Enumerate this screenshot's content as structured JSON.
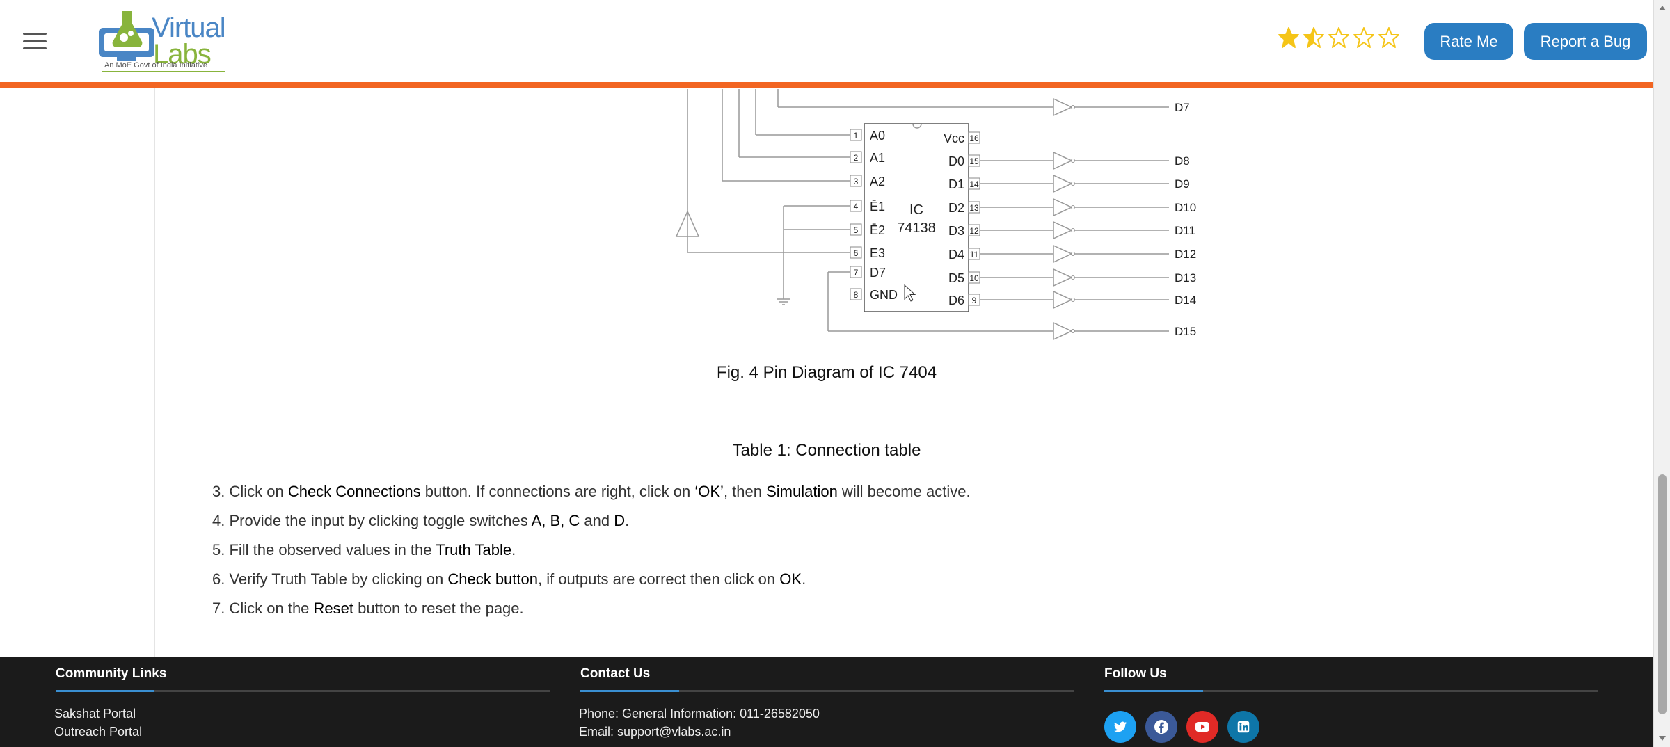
{
  "header": {
    "logo": {
      "line1": "Virtual",
      "line2": "Labs",
      "tagline": "An MoE Govt of India Initiative"
    },
    "rating": {
      "value": 1.5,
      "max": 5
    },
    "rate_label": "Rate Me",
    "bug_label": "Report a Bug"
  },
  "diagram": {
    "ic_label": "IC",
    "ic_number": "74138",
    "left_pins": [
      {
        "num": "1",
        "name": "A0"
      },
      {
        "num": "2",
        "name": "A1"
      },
      {
        "num": "3",
        "name": "A2"
      },
      {
        "num": "4",
        "name": "Ē1"
      },
      {
        "num": "5",
        "name": "Ē2"
      },
      {
        "num": "6",
        "name": "E3"
      },
      {
        "num": "7",
        "name": "D7"
      },
      {
        "num": "8",
        "name": "GND"
      }
    ],
    "right_pins": [
      {
        "num": "16",
        "name": "Vcc"
      },
      {
        "num": "15",
        "name": "D0"
      },
      {
        "num": "14",
        "name": "D1"
      },
      {
        "num": "13",
        "name": "D2"
      },
      {
        "num": "12",
        "name": "D3"
      },
      {
        "num": "11",
        "name": "D4"
      },
      {
        "num": "10",
        "name": "D5"
      },
      {
        "num": "9",
        "name": "D6"
      }
    ],
    "outputs": [
      "D7",
      "D8",
      "D9",
      "D10",
      "D11",
      "D12",
      "D13",
      "D14",
      "D15"
    ]
  },
  "content": {
    "fig_caption": "Fig. 4 Pin Diagram of IC 7404",
    "table_caption": "Table 1: Connection table",
    "steps": [
      {
        "num": "3.",
        "parts": [
          "Click on ",
          "Check Connections",
          " button. If connections are right, click on ",
          "‘OK’",
          ", then ",
          "Simulation",
          " will become active."
        ]
      },
      {
        "num": "4.",
        "parts": [
          "Provide the input by clicking toggle switches ",
          "A, B, C",
          " and ",
          "D",
          "."
        ]
      },
      {
        "num": "5.",
        "parts": [
          "Fill the observed values in the ",
          "Truth Table",
          "."
        ]
      },
      {
        "num": "6.",
        "parts": [
          "Verify Truth Table by clicking on ",
          "Check button",
          ", if outputs are correct then click on ",
          "OK",
          "."
        ]
      },
      {
        "num": "7.",
        "parts": [
          "Click on the ",
          "Reset",
          " button to reset the page."
        ]
      }
    ]
  },
  "footer": {
    "community": {
      "title": "Community Links",
      "links": [
        "Sakshat Portal",
        "Outreach Portal"
      ]
    },
    "contact": {
      "title": "Contact Us",
      "phone": "Phone: General Information: 011-26582050",
      "email": "Email: support@vlabs.ac.in"
    },
    "follow": {
      "title": "Follow Us",
      "icons": [
        "twitter-icon",
        "facebook-icon",
        "youtube-icon",
        "linkedin-icon"
      ]
    }
  },
  "colors": {
    "accent_orange": "#f26522",
    "button_blue": "#2a7dc2",
    "star_gold": "#f5c518",
    "footer_bg": "#1b1b1b"
  }
}
